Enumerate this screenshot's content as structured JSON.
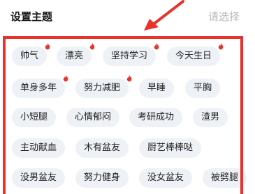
{
  "header": {
    "title": "设置主题",
    "select_placeholder": "请选择"
  },
  "tags": [
    {
      "label": "帅气",
      "hot": true
    },
    {
      "label": "漂亮",
      "hot": true
    },
    {
      "label": "坚持学习",
      "hot": true
    },
    {
      "label": "今天生日",
      "hot": true
    },
    {
      "label": "单身多年",
      "hot": true
    },
    {
      "label": "努力减肥",
      "hot": true
    },
    {
      "label": "早睡",
      "hot": false
    },
    {
      "label": "平胸",
      "hot": false
    },
    {
      "label": "小短腿",
      "hot": false
    },
    {
      "label": "心情郁闷",
      "hot": false
    },
    {
      "label": "考研成功",
      "hot": false
    },
    {
      "label": "渣男",
      "hot": false
    },
    {
      "label": "主动献血",
      "hot": false
    },
    {
      "label": "木有盆友",
      "hot": false
    },
    {
      "label": "厨艺棒棒哒",
      "hot": false
    },
    {
      "label": "没男盆友",
      "hot": false
    },
    {
      "label": "努力健身",
      "hot": false
    },
    {
      "label": "没女盆友",
      "hot": false
    },
    {
      "label": "被劈腿",
      "hot": false
    }
  ],
  "colors": {
    "annotation_red": "#e8322e",
    "tag_background": "#eef1f6",
    "placeholder_gray": "#b8b8b8"
  },
  "icons": {
    "hot_badge": "flame-icon",
    "annotation": "red-arrow-icon"
  }
}
